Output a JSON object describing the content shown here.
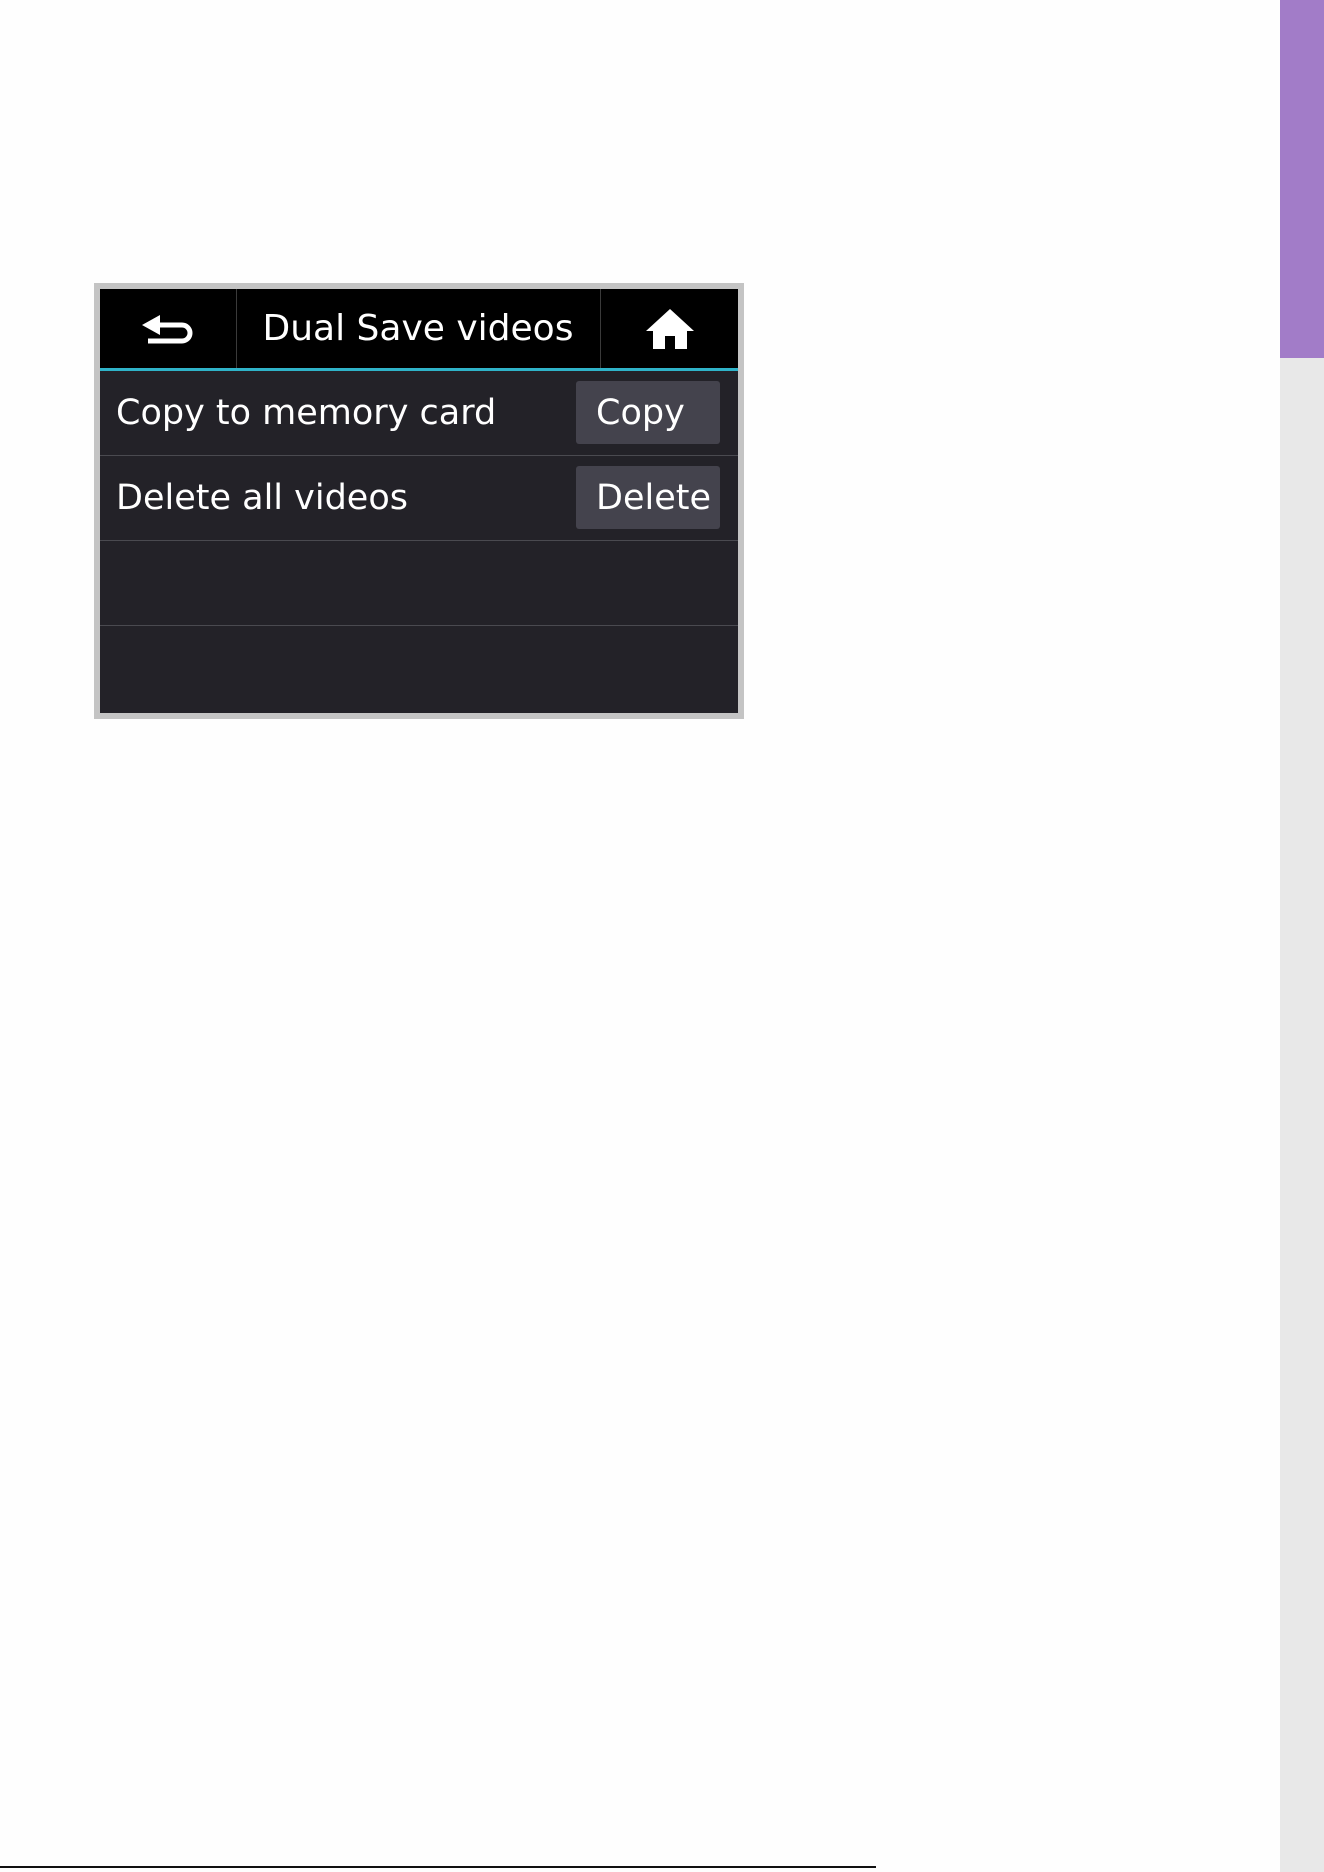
{
  "page": {
    "side_tab_color": "#a27cc8"
  },
  "screen": {
    "header": {
      "back_icon": "back-arrow-icon",
      "title": "Dual Save videos",
      "home_icon": "home-icon",
      "accent_color": "#2fb3c9"
    },
    "rows": [
      {
        "label": "Copy to memory card",
        "button": "Copy"
      },
      {
        "label": "Delete all videos",
        "button": "Delete"
      },
      {
        "label": ""
      },
      {
        "label": ""
      }
    ]
  }
}
